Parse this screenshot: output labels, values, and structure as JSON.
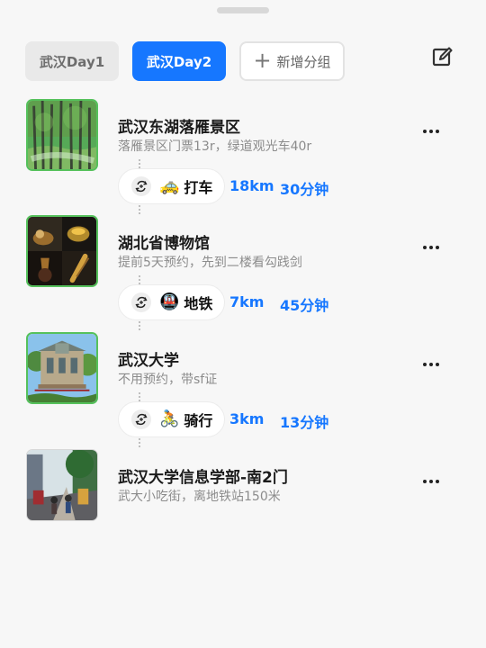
{
  "tabs": {
    "items": [
      {
        "label": "武汉Day1",
        "active": false
      },
      {
        "label": "武汉Day2",
        "active": true
      }
    ],
    "add_label": "新增分组"
  },
  "colors": {
    "accent": "#1677ff",
    "thumbnail_highlight": "#56c15c"
  },
  "icons": {
    "edit": "edit-square-icon",
    "more": "more-dots-icon",
    "switch": "switch-route-icon"
  },
  "places": [
    {
      "title": "武汉东湖落雁景区",
      "note": "落雁景区门票13r，绿道观光车40r"
    },
    {
      "title": "湖北省博物馆",
      "note": "提前5天预约，先到二楼看勾践剑"
    },
    {
      "title": "武汉大学",
      "note": "不用预约，带sf证"
    },
    {
      "title": "武汉大学信息学部-南2门",
      "note": "武大小吃街，离地铁站150米"
    }
  ],
  "transports": [
    {
      "icon": "taxi-icon",
      "emoji": "🚕",
      "mode": "打车",
      "distance": "18km",
      "duration": "30分钟"
    },
    {
      "icon": "subway-icon",
      "emoji": "🚇",
      "mode": "地铁",
      "distance": "7km",
      "duration": "45分钟"
    },
    {
      "icon": "bicycle-icon",
      "emoji": "🚴",
      "mode": "骑行",
      "distance": "3km",
      "duration": "13分钟"
    }
  ]
}
